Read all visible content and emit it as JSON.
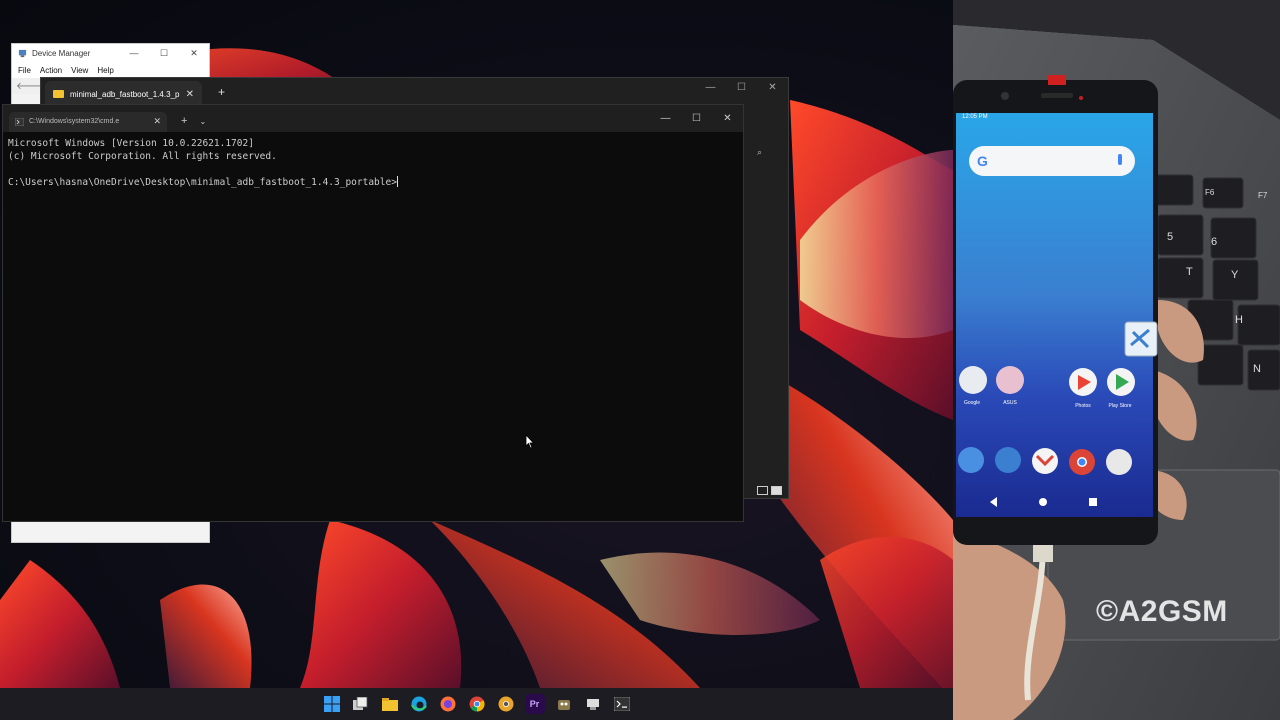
{
  "device_manager": {
    "title": "Device Manager",
    "menu": [
      "File",
      "Action",
      "View",
      "Help"
    ]
  },
  "explorer": {
    "tab_title": "minimal_adb_fastboot_1.4.3_p",
    "new_tab": "+"
  },
  "terminal": {
    "tab_title": "C:\\Windows\\system32\\cmd.e",
    "new_tab": "+",
    "lines": [
      "Microsoft Windows [Version 10.0.22621.1702]",
      "(c) Microsoft Corporation. All rights reserved.",
      "",
      "C:\\Users\\hasna\\OneDrive\\Desktop\\minimal_adb_fastboot_1.4.3_portable>"
    ]
  },
  "window_controls": {
    "minimize": "—",
    "maximize": "☐",
    "close": "✕"
  },
  "taskbar": {
    "icons": [
      "windows-start-icon",
      "task-view-icon",
      "file-explorer-icon",
      "edge-icon",
      "firefox-icon",
      "chrome-icon",
      "chrome-canary-icon",
      "premiere-pro-icon",
      "gimp-icon",
      "app-icon",
      "terminal-icon"
    ],
    "premiere_label": "Pr"
  },
  "phone": {
    "time": "12:05 PM",
    "apps_row": [
      "Google",
      "ASUS",
      "Photos",
      "Play Store"
    ]
  },
  "watermark": "©A2GSM",
  "colors": {
    "terminal_bg": "#0c0c0c",
    "terminal_text": "#cccccc",
    "taskbar_bg": "#1c1c22",
    "wallpaper_accent": "#d8351f"
  }
}
